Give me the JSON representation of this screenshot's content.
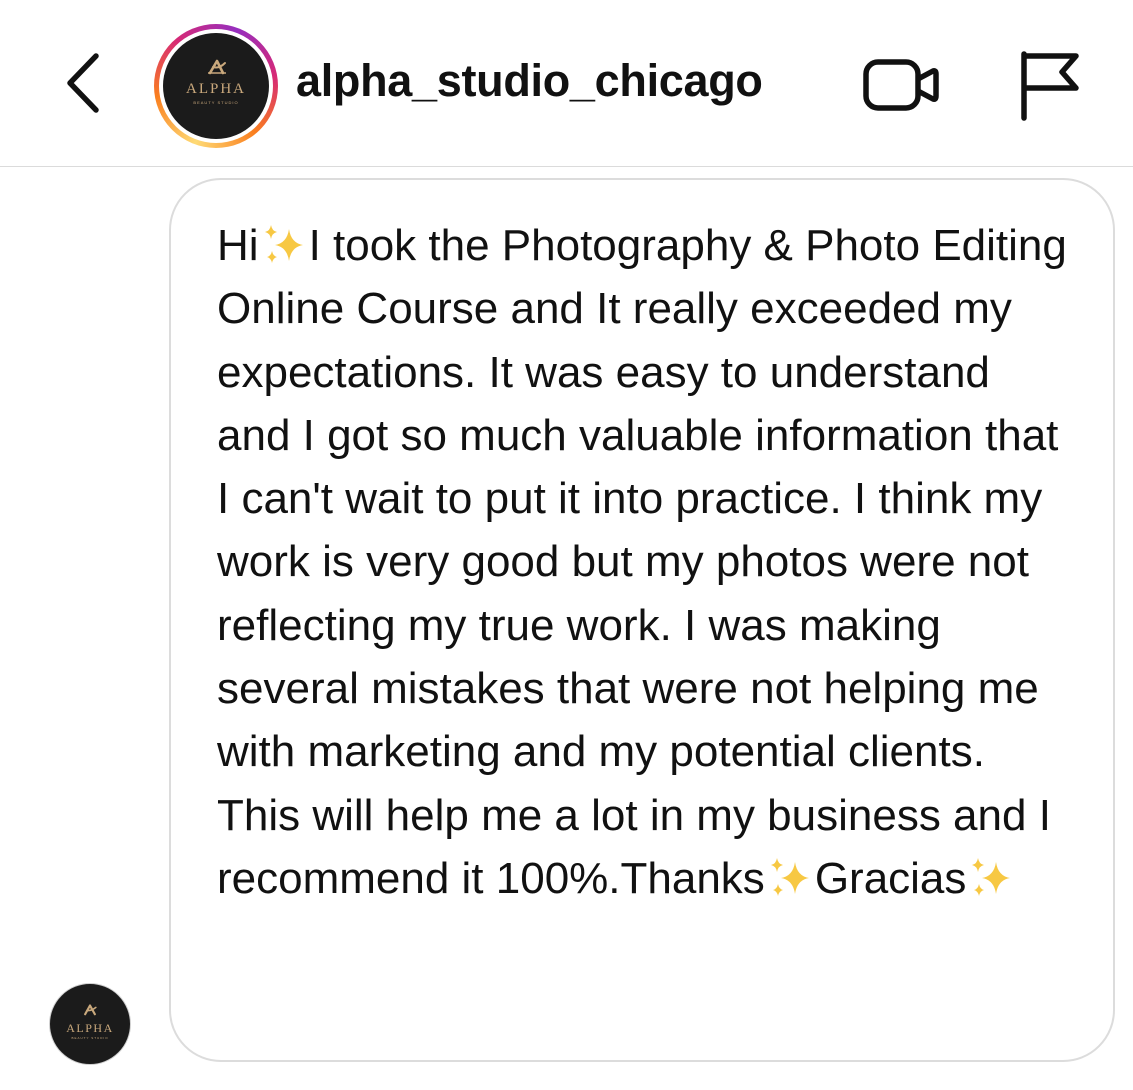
{
  "header": {
    "username": "alpha_studio_chicago",
    "back_icon": "chevron-left-icon",
    "video_icon": "video-camera-icon",
    "flag_icon": "flag-icon"
  },
  "avatar": {
    "brand_name": "ALPHA",
    "brand_sub": "BEAUTY STUDIO",
    "ring_colors": [
      "#feda75",
      "#fa7e1e",
      "#d62976",
      "#962fbf"
    ],
    "background": "#1b1b1b",
    "text_color": "#c9a87c"
  },
  "message": {
    "part1": "Hi",
    "part2": "I took the Photography & Photo Editing Online Course and It really exceeded my expectations. It was easy to understand and I got so much valuable information that I can't wait to put it into practice. I think my work is very good but my photos were not reflecting my true work. I was making several mistakes that were not helping me with marketing and my potential clients. This will help me a lot in my business and I recommend it 100%.Thanks",
    "part3": "Gracias",
    "emoji_icon": "sparkles-icon"
  },
  "colors": {
    "sparkle": "#f7c843",
    "bubble_border": "#dcdcdc",
    "divider": "#dbdbdb"
  }
}
